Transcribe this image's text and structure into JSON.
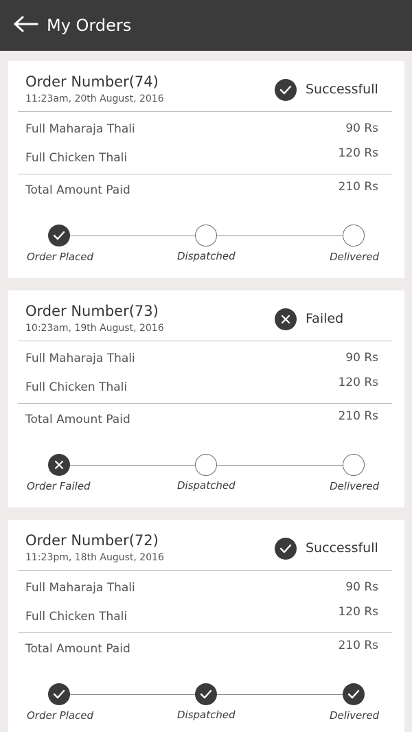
{
  "header": {
    "title": "My Orders",
    "back_icon": "arrow-left-icon"
  },
  "orders": [
    {
      "title": "Order Number(74)",
      "time": "11:23am, 20th August, 2016",
      "status": "Successfull",
      "status_icon": "check-icon",
      "items": [
        {
          "name": "Full Maharaja Thali",
          "price": "90 Rs"
        },
        {
          "name": "Full Chicken Thali",
          "price": "120 Rs"
        }
      ],
      "total_label": "Total Amount Paid",
      "total": "210 Rs",
      "steps": [
        {
          "label": "Order Placed",
          "state": "done",
          "icon": "check-icon"
        },
        {
          "label": "Dispatched",
          "state": "pending"
        },
        {
          "label": "Delivered",
          "state": "pending"
        }
      ]
    },
    {
      "title": "Order Number(73)",
      "time": "10:23am, 19th August, 2016",
      "status": "Failed",
      "status_icon": "close-icon",
      "items": [
        {
          "name": "Full Maharaja Thali",
          "price": "90 Rs"
        },
        {
          "name": "Full Chicken Thali",
          "price": "120 Rs"
        }
      ],
      "total_label": "Total Amount Paid",
      "total": "210 Rs",
      "steps": [
        {
          "label": "Order Failed",
          "state": "done",
          "icon": "close-icon"
        },
        {
          "label": "Dispatched",
          "state": "pending"
        },
        {
          "label": "Delivered",
          "state": "pending"
        }
      ]
    },
    {
      "title": "Order Number(72)",
      "time": "11:23pm, 18th August, 2016",
      "status": "Successfull",
      "status_icon": "check-icon",
      "items": [
        {
          "name": "Full Maharaja Thali",
          "price": "90 Rs"
        },
        {
          "name": "Full Chicken Thali",
          "price": "120 Rs"
        }
      ],
      "total_label": "Total Amount Paid",
      "total": "210 Rs",
      "steps": [
        {
          "label": "Order Placed",
          "state": "done",
          "icon": "check-icon"
        },
        {
          "label": "Dispatched",
          "state": "done",
          "icon": "check-icon"
        },
        {
          "label": "Delivered",
          "state": "done",
          "icon": "check-icon"
        }
      ]
    }
  ],
  "colors": {
    "header_bg": "#3b3b3b",
    "page_bg": "#efebea",
    "card_bg": "#ffffff",
    "accent": "#3b3b3b"
  }
}
